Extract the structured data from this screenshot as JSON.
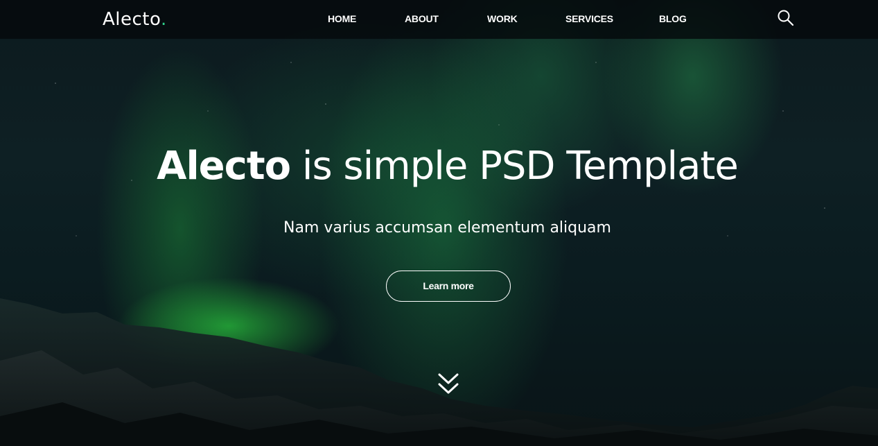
{
  "brand": {
    "logo_text": "Alecto",
    "logo_dot": ".",
    "accent_color": "#2fcf8a"
  },
  "nav": {
    "items": [
      {
        "label": "HOME"
      },
      {
        "label": "ABOUT"
      },
      {
        "label": "WORK"
      },
      {
        "label": "SERVICES"
      },
      {
        "label": "BLOG"
      }
    ],
    "search_icon": "search-icon"
  },
  "hero": {
    "title_brand": "Alecto",
    "title_rest": " is simple PSD Template",
    "subtitle": "Nam varius accumsan elementum aliquam",
    "cta_label": "Learn more",
    "scroll_icon": "double-chevron-down-icon"
  }
}
